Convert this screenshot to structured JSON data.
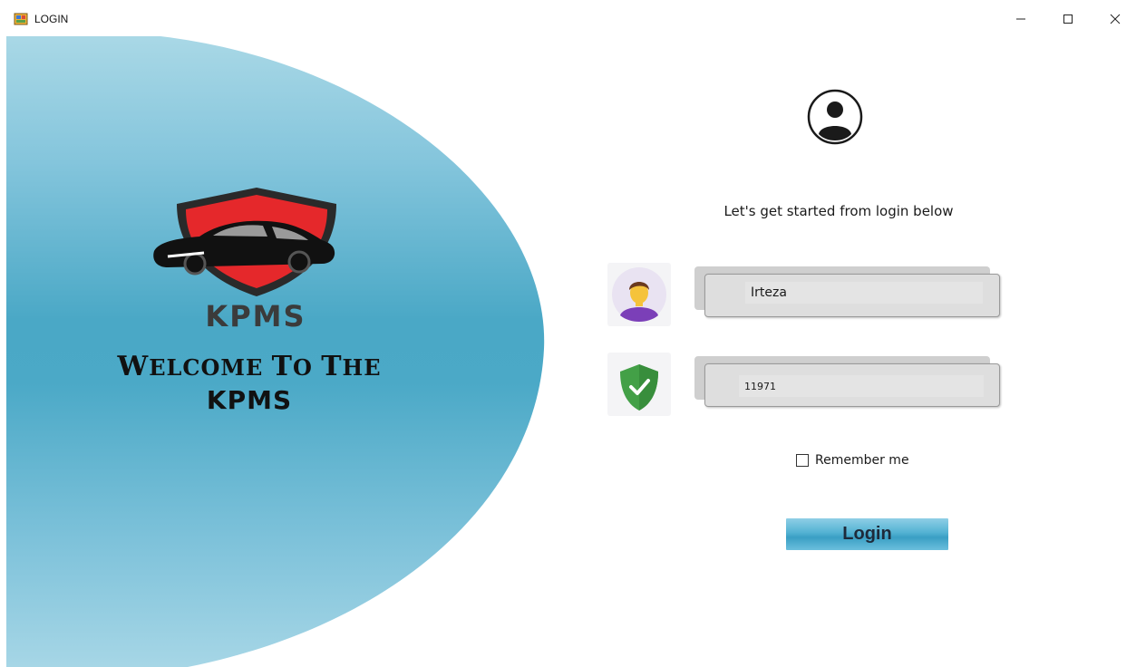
{
  "window": {
    "title": "LOGIN",
    "controls": {
      "minimize": "–",
      "maximize": "☐",
      "close": "✕"
    }
  },
  "left_panel": {
    "brand": "KPMS",
    "welcome_line1_parts": [
      "W",
      "ELCOME",
      " ",
      "T",
      "O",
      " ",
      "T",
      "HE"
    ],
    "welcome_line1": "WELCOME TO THE",
    "welcome_line2": "KPMS",
    "colors": {
      "blob_light": "#a6d5e3",
      "blob_mid": "#4ba9c6",
      "shield_red": "#e5282b",
      "shield_outline": "#2a2a2a"
    },
    "icons": {
      "logo": "car-shield-logo"
    }
  },
  "right_panel": {
    "tagline": "Let's get started from login below",
    "icons": {
      "profile": "user-circle-icon",
      "username": "person-avatar-icon",
      "password": "green-shield-check-icon"
    },
    "username": {
      "value": "Irteza"
    },
    "password": {
      "value": "11971"
    },
    "remember_me": {
      "label": "Remember me",
      "checked": false
    },
    "login_button": "Login",
    "colors": {
      "shield_green": "#43a047",
      "avatar_bg": "#e9e3f2",
      "avatar_shirt": "#7b3fb8",
      "avatar_skin": "#f5c33b"
    }
  }
}
